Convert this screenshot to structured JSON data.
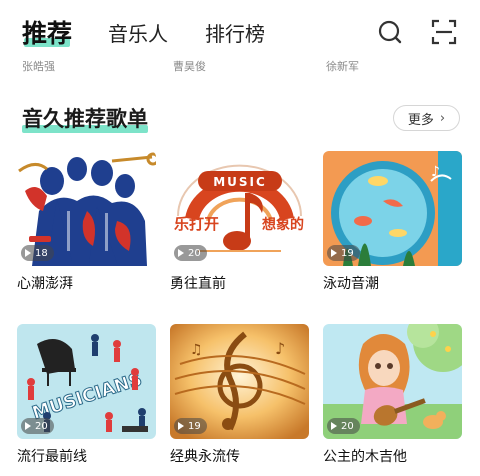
{
  "tabs": [
    {
      "label": "推荐",
      "active": true
    },
    {
      "label": "音乐人",
      "active": false
    },
    {
      "label": "排行榜",
      "active": false
    }
  ],
  "header_icons": [
    "search-icon",
    "scan-icon"
  ],
  "artists": [
    "张皓强",
    "曹昊俊",
    "徐新军"
  ],
  "section": {
    "title": "音久推荐歌单",
    "more_label": "更多"
  },
  "playlists": [
    {
      "title": "心潮澎湃",
      "count": "18"
    },
    {
      "title": "勇往直前",
      "count": "20",
      "cover_text": "MUSIC",
      "cover_text_left": "乐打开",
      "cover_text_right": "想象的"
    },
    {
      "title": "泳动音潮",
      "count": "19"
    },
    {
      "title": "流行最前线",
      "count": "20",
      "cover_text": "MUSICIANS"
    },
    {
      "title": "经典永流传",
      "count": "19"
    },
    {
      "title": "公主的木吉他",
      "count": "20"
    }
  ],
  "colors": {
    "accent": "#7de3c9",
    "text": "#111111",
    "muted": "#8a8a8a"
  }
}
